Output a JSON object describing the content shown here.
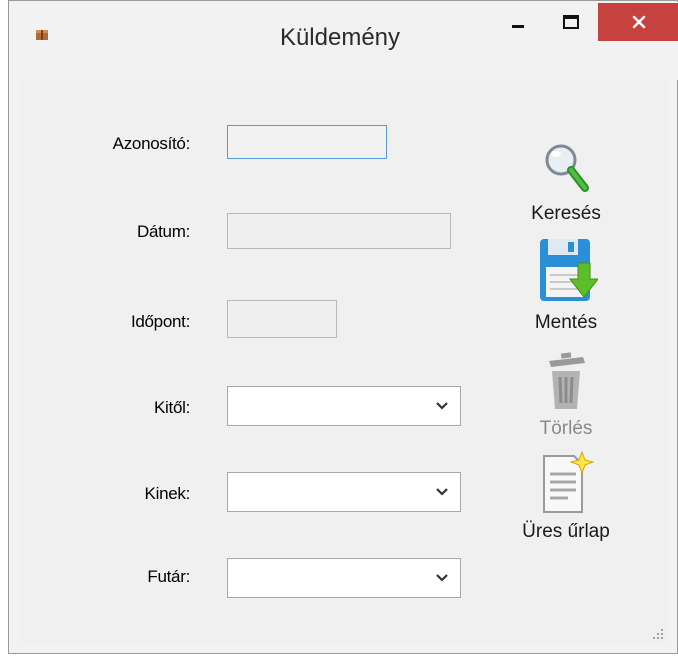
{
  "window": {
    "title": "Küldemény",
    "controls": {
      "minimize": "minimize",
      "maximize": "maximize",
      "close": "close"
    }
  },
  "form": {
    "azonosito_label": "Azonosító:",
    "datum_label": "Dátum:",
    "idopont_label": "Időpont:",
    "kitol_label": "Kitől:",
    "kinek_label": "Kinek:",
    "futar_label": "Futár:",
    "azonosito_value": "",
    "datum_value": "",
    "idopont_value": "",
    "kitol_value": "",
    "kinek_value": "",
    "futar_value": ""
  },
  "actions": {
    "search_label": "Keresés",
    "save_label": "Mentés",
    "delete_label": "Törlés",
    "delete_enabled": false,
    "new_form_label": "Üres űrlap"
  },
  "colors": {
    "close_button": "#c7423f",
    "focus_border": "#5a9bd6",
    "save_icon_blue": "#2a8fd6",
    "save_arrow_green": "#5cbf2a"
  }
}
